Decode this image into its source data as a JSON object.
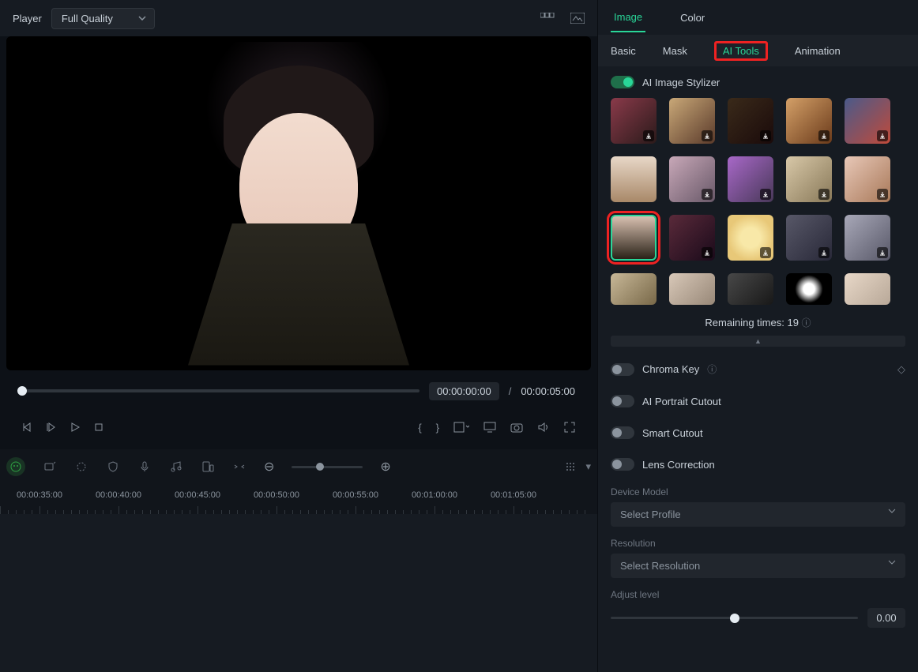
{
  "player": {
    "label": "Player",
    "quality": "Full Quality"
  },
  "time": {
    "current": "00:00:00:00",
    "sep": "/",
    "total": "00:00:05:00"
  },
  "ruler": [
    "00:00:35:00",
    "00:00:40:00",
    "00:00:45:00",
    "00:00:50:00",
    "00:00:55:00",
    "00:01:00:00",
    "00:01:05:00"
  ],
  "topTabs": {
    "image": "Image",
    "color": "Color"
  },
  "subTabs": {
    "basic": "Basic",
    "mask": "Mask",
    "aitools": "AI Tools",
    "animation": "Animation"
  },
  "features": {
    "stylizer": "AI Image Stylizer",
    "remaining": "Remaining times: 19",
    "chroma": "Chroma Key",
    "portrait": "AI Portrait Cutout",
    "smart": "Smart Cutout",
    "lens": "Lens Correction"
  },
  "form": {
    "deviceLabel": "Device Model",
    "devicePlaceholder": "Select Profile",
    "resLabel": "Resolution",
    "resPlaceholder": "Select Resolution",
    "adjustLabel": "Adjust level",
    "adjustValue": "0.00"
  }
}
